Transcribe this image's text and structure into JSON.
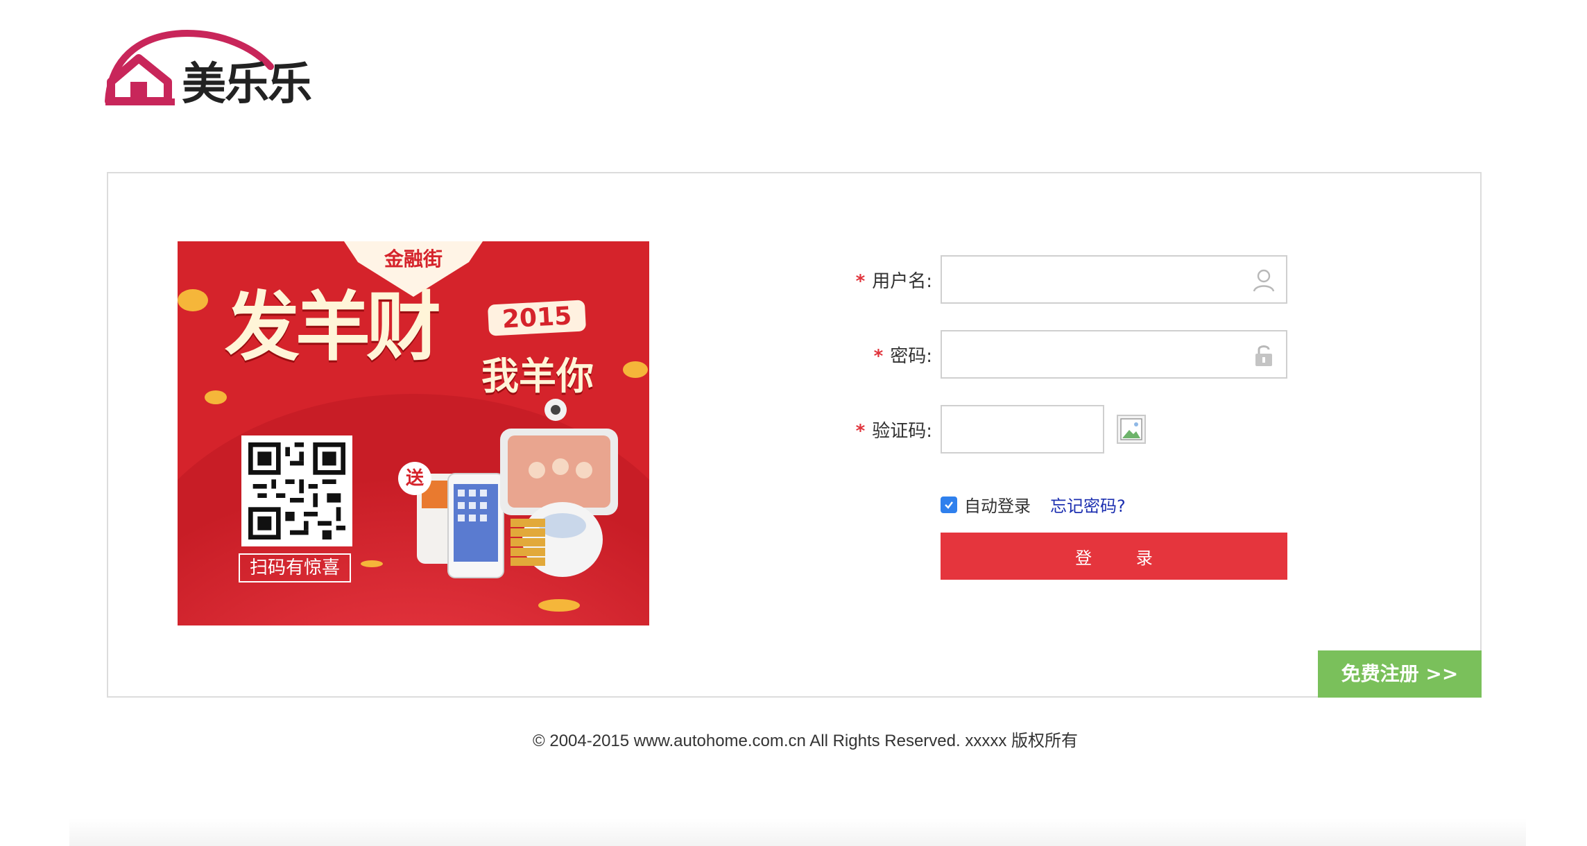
{
  "header": {
    "logo_text": "美乐乐"
  },
  "banner": {
    "top_label": "金融街",
    "headline": "发羊财",
    "year": "2015",
    "sub_headline": "我羊你",
    "send_badge": "送",
    "qr_caption": "扫码有惊喜"
  },
  "form": {
    "required_mark": "*",
    "username_label": "用户名:",
    "password_label": "密码:",
    "captcha_label": "验证码:",
    "username_value": "",
    "password_value": "",
    "captcha_value": "",
    "remember_label": "自动登录",
    "remember_checked": true,
    "forgot_link": "忘记密码?",
    "login_button": "登 录"
  },
  "register_button": "免费注册 >>",
  "footer": {
    "copyright": "© 2004-2015 www.autohome.com.cn All Rights Reserved. xxxxx 版权所有"
  },
  "colors": {
    "brand_red": "#e5353d",
    "register_green": "#7ac05b",
    "link_blue": "#1c2fb0",
    "logo_pink": "#c8265a"
  }
}
